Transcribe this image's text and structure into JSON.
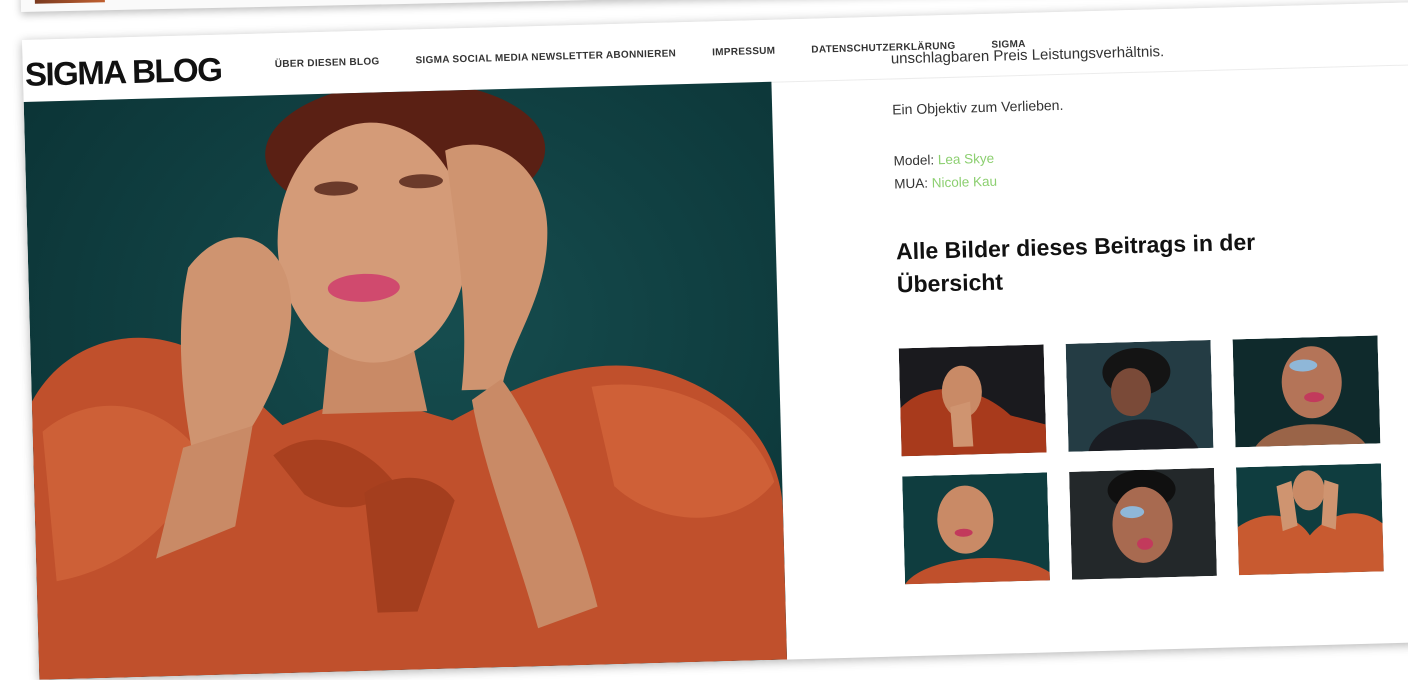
{
  "site": {
    "brand": "SIGMA BLOG"
  },
  "nav": {
    "items": [
      "ÜBER DIESEN BLOG",
      "SIGMA SOCIAL MEDIA NEWSLETTER ABONNIEREN",
      "IMPRESSUM",
      "DATENSCHUTZERKLÄRUNG",
      "SIGMA"
    ]
  },
  "article": {
    "text_top": "unschlagbaren Preis Leistungsverhältnis.",
    "text_love": "Ein Objektiv zum Verlieben.",
    "model_label": "Model: ",
    "model_name": "Lea Skye",
    "mua_label": "MUA: ",
    "mua_name": "Nicole Kau",
    "overview_title": "Alle Bilder dieses Beitrags in der Übersicht"
  },
  "colors": {
    "accent_link": "#8ccf70",
    "teal_background": "#0f3d3f",
    "dress_orange": "#c0502c"
  },
  "icons": {
    "hero": "portrait-photo",
    "thumbnails": [
      "portrait-thumbnail",
      "portrait-thumbnail",
      "portrait-thumbnail",
      "portrait-thumbnail",
      "portrait-thumbnail",
      "portrait-thumbnail"
    ]
  }
}
